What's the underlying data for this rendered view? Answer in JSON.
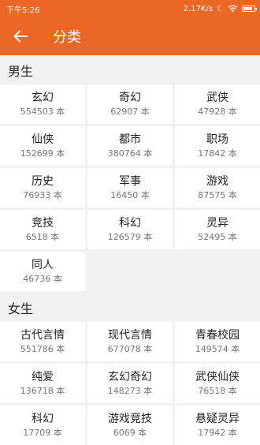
{
  "statusbar": {
    "time": "下午5:26",
    "speed": "2.17K/s"
  },
  "header": {
    "title": "分类"
  },
  "sections": [
    {
      "title": "男生",
      "items": [
        {
          "name": "玄幻",
          "count": "554503 本"
        },
        {
          "name": "奇幻",
          "count": "62907 本"
        },
        {
          "name": "武侠",
          "count": "47928 本"
        },
        {
          "name": "仙侠",
          "count": "152699 本"
        },
        {
          "name": "都市",
          "count": "380764 本"
        },
        {
          "name": "职场",
          "count": "17842 本"
        },
        {
          "name": "历史",
          "count": "76933 本"
        },
        {
          "name": "军事",
          "count": "16450 本"
        },
        {
          "name": "游戏",
          "count": "87575 本"
        },
        {
          "name": "竞技",
          "count": "6518 本"
        },
        {
          "name": "科幻",
          "count": "126579 本"
        },
        {
          "name": "灵异",
          "count": "52495 本"
        },
        {
          "name": "同人",
          "count": "46736 本"
        }
      ]
    },
    {
      "title": "女生",
      "items": [
        {
          "name": "古代言情",
          "count": "551786 本"
        },
        {
          "name": "现代言情",
          "count": "677078 本"
        },
        {
          "name": "青春校园",
          "count": "149574 本"
        },
        {
          "name": "纯爱",
          "count": "136718 本"
        },
        {
          "name": "玄幻奇幻",
          "count": "148273 本"
        },
        {
          "name": "武侠仙侠",
          "count": "76518 本"
        },
        {
          "name": "科幻",
          "count": "17709 本"
        },
        {
          "name": "游戏竞技",
          "count": "6069 本"
        },
        {
          "name": "悬疑灵异",
          "count": "17942 本"
        }
      ]
    }
  ]
}
